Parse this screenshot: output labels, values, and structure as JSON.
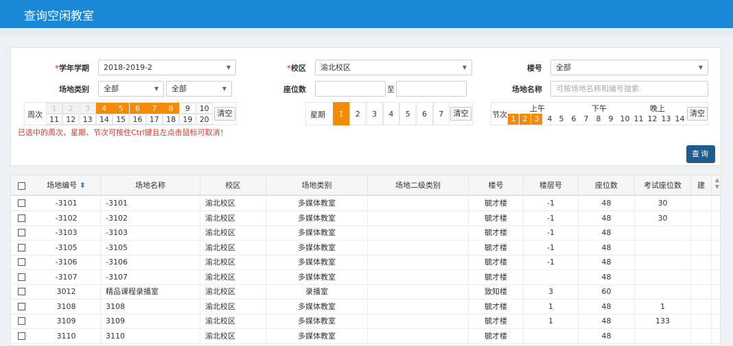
{
  "header": {
    "title": "查询空闲教室"
  },
  "form": {
    "term_label": "学年学期",
    "term_value": "2018-2019-2",
    "campus_label": "校区",
    "campus_value": "渝北校区",
    "building_label": "楼号",
    "building_value": "全部",
    "type_label": "场地类别",
    "type_value1": "全部",
    "type_value2": "全部",
    "seats_label": "座位数",
    "seats_to": "至",
    "name_label": "场地名称",
    "name_placeholder": "可按场地名称和编号搜索",
    "week_label": "周次",
    "weeks_row1": [
      "1",
      "2",
      "3",
      "4",
      "5",
      "6",
      "7",
      "8",
      "9",
      "10"
    ],
    "weeks_row2": [
      "11",
      "12",
      "13",
      "14",
      "15",
      "16",
      "17",
      "18",
      "19",
      "20"
    ],
    "weeks_selected": [
      "4",
      "5",
      "6",
      "7",
      "8"
    ],
    "weeks_disabled": [
      "1",
      "2",
      "3"
    ],
    "clear": "清空",
    "weekday_label": "星期",
    "weekdays": [
      "1",
      "2",
      "3",
      "4",
      "5",
      "6",
      "7"
    ],
    "weekday_selected": [
      "1"
    ],
    "section_label": "节次",
    "periods": [
      "上午",
      "下午",
      "晚上"
    ],
    "sections": [
      "1",
      "2",
      "3",
      "4",
      "5",
      "6",
      "7",
      "8",
      "9",
      "10",
      "11",
      "12",
      "13",
      "14"
    ],
    "sections_selected": [
      "1",
      "2",
      "3"
    ],
    "warning": "已选中的周次、星期、节次可按住Ctrl键且左点击鼠标可取消！",
    "query": "查询",
    "required_mark": "*"
  },
  "table": {
    "headers": [
      "场地编号",
      "场地名称",
      "校区",
      "场地类别",
      "场地二级类别",
      "楼号",
      "楼层号",
      "座位数",
      "考试座位数",
      "建"
    ],
    "rows": [
      [
        "-3101",
        "-3101",
        "渝北校区",
        "多媒体教室",
        "",
        "毓才楼",
        "-1",
        "48",
        "30"
      ],
      [
        "-3102",
        "-3102",
        "渝北校区",
        "多媒体教室",
        "",
        "毓才楼",
        "-1",
        "48",
        "30"
      ],
      [
        "-3103",
        "-3103",
        "渝北校区",
        "多媒体教室",
        "",
        "毓才楼",
        "-1",
        "48",
        ""
      ],
      [
        "-3105",
        "-3105",
        "渝北校区",
        "多媒体教室",
        "",
        "毓才楼",
        "-1",
        "48",
        ""
      ],
      [
        "-3106",
        "-3106",
        "渝北校区",
        "多媒体教室",
        "",
        "毓才楼",
        "-1",
        "48",
        ""
      ],
      [
        "-3107",
        "-3107",
        "渝北校区",
        "多媒体教室",
        "",
        "毓才楼",
        "",
        "48",
        ""
      ],
      [
        "3012",
        "精品课程录播室",
        "渝北校区",
        "录播室",
        "",
        "致知楼",
        "3",
        "60",
        ""
      ],
      [
        "3108",
        "3108",
        "渝北校区",
        "多媒体教室",
        "",
        "毓才楼",
        "1",
        "48",
        "1"
      ],
      [
        "3109",
        "3109",
        "渝北校区",
        "多媒体教室",
        "",
        "毓才楼",
        "1",
        "48",
        "133"
      ],
      [
        "3110",
        "3110",
        "渝北校区",
        "多媒体教室",
        "",
        "毓才楼",
        "",
        "48",
        ""
      ]
    ]
  },
  "colors": {
    "header": "#1a88d6",
    "selected": "#f58a07",
    "query_button": "#1e5b8f",
    "warning": "#d9372c"
  }
}
